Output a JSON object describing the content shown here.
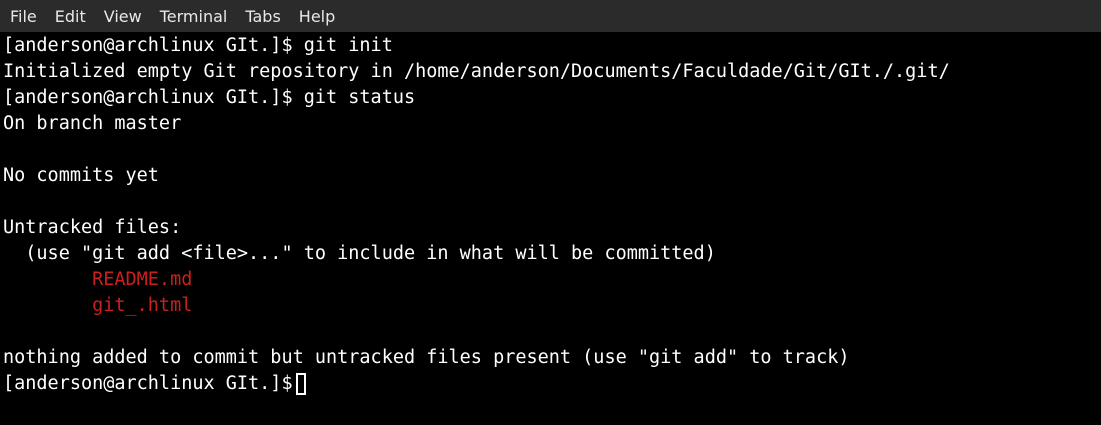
{
  "menu": {
    "items": [
      "File",
      "Edit",
      "View",
      "Terminal",
      "Tabs",
      "Help"
    ]
  },
  "terminal": {
    "prompt": "[anderson@archlinux GIt.]$",
    "lines": [
      "[anderson@archlinux GIt.]$ git init",
      "Initialized empty Git repository in /home/anderson/Documents/Faculdade/Git/GIt./.git/",
      "[anderson@archlinux GIt.]$ git status",
      "On branch master",
      "",
      "No commits yet",
      "",
      "Untracked files:",
      "  (use \"git add <file>...\" to include in what will be committed)",
      "        README.md",
      "        git_.html",
      "",
      "nothing added to commit but untracked files present (use \"git add\" to track)"
    ],
    "untracked_color": "#cc1f1f",
    "text_color": "#ffffff",
    "background": "#000000"
  }
}
